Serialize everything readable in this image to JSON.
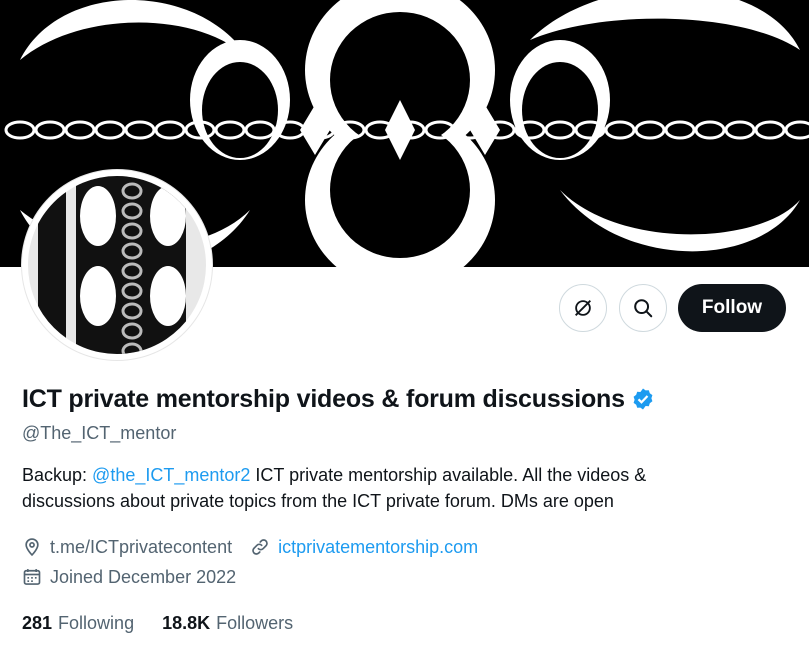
{
  "banner": {
    "image": "fractal-moon-pattern-banner"
  },
  "avatar": {
    "image": "fractal-chain-avatar"
  },
  "actions": {
    "more_icon": "circle-slash-icon",
    "search_icon": "search-icon",
    "follow_label": "Follow"
  },
  "profile": {
    "name": "ICT private mentorship videos & forum discussions",
    "verified_icon": "verified-badge-icon",
    "handle": "@The_ICT_mentor",
    "bio_prefix": "Backup: ",
    "bio_mention": "@the_ICT_mentor2",
    "bio_line1_rest": " ICT private mentorship available. All the videos &",
    "bio_line2": "discussions about private topics from the ICT private forum. DMs are open",
    "location": "t.me/ICTprivatecontent",
    "location_icon": "location-pin-icon",
    "website": "ictprivatementorship.com",
    "website_icon": "link-icon",
    "joined": "Joined December 2022",
    "joined_icon": "calendar-icon"
  },
  "stats": {
    "following_count": "281",
    "following_label": "Following",
    "followers_count": "18.8K",
    "followers_label": "Followers"
  },
  "colors": {
    "accent": "#1d9bf0",
    "text": "#0f1419",
    "secondary": "#536471",
    "follow_bg": "#0f1419"
  }
}
